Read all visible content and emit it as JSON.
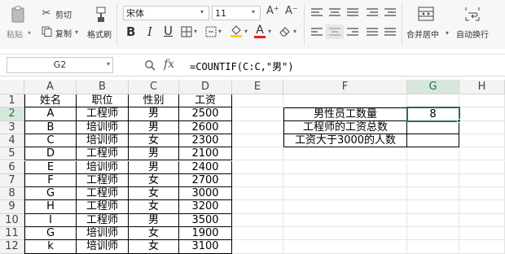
{
  "ribbon": {
    "paste_label": "粘贴",
    "cut_label": "剪切",
    "copy_label": "复制",
    "format_painter_label": "格式刷",
    "font_name": "宋体",
    "font_size": "11",
    "merge_label": "合并居中",
    "wrap_label": "自动换行",
    "bold": "B",
    "italic": "I",
    "underline": "U",
    "font_color_glyph": "A",
    "grow_font": "A⁺",
    "shrink_font": "A⁻",
    "accent_colors": {
      "font_color": "#e02020",
      "fill_color": "#ffd200"
    }
  },
  "formula_bar": {
    "name_box": "G2",
    "fx": "fx",
    "formula": "=COUNTIF(C:C,\"男\")"
  },
  "sheet": {
    "columns": [
      "A",
      "B",
      "C",
      "D",
      "E",
      "F",
      "G",
      "H"
    ],
    "selected_column": "G",
    "selected_row": "2",
    "rows": [
      {
        "n": "1",
        "a": "姓名",
        "b": "职位",
        "c": "性别",
        "d": "工资"
      },
      {
        "n": "2",
        "a": "A",
        "b": "工程师",
        "c": "男",
        "d": "2500"
      },
      {
        "n": "3",
        "a": "B",
        "b": "培训师",
        "c": "男",
        "d": "2600"
      },
      {
        "n": "4",
        "a": "C",
        "b": "培训师",
        "c": "女",
        "d": "2300"
      },
      {
        "n": "5",
        "a": "D",
        "b": "工程师",
        "c": "男",
        "d": "2100"
      },
      {
        "n": "6",
        "a": "E",
        "b": "培训师",
        "c": "男",
        "d": "2400"
      },
      {
        "n": "7",
        "a": "F",
        "b": "工程师",
        "c": "女",
        "d": "2700"
      },
      {
        "n": "8",
        "a": "G",
        "b": "工程师",
        "c": "女",
        "d": "3000"
      },
      {
        "n": "9",
        "a": "H",
        "b": "工程师",
        "c": "女",
        "d": "3200"
      },
      {
        "n": "10",
        "a": "I",
        "b": "工程师",
        "c": "男",
        "d": "3500"
      },
      {
        "n": "11",
        "a": "G",
        "b": "培训师",
        "c": "女",
        "d": "1900"
      },
      {
        "n": "12",
        "a": "k",
        "b": "培训师",
        "c": "女",
        "d": "3100"
      }
    ],
    "summary": [
      {
        "label": "男性员工数量",
        "value": "8"
      },
      {
        "label": "工程师的工资总数",
        "value": ""
      },
      {
        "label": "工资大于3000的人数",
        "value": ""
      }
    ]
  }
}
